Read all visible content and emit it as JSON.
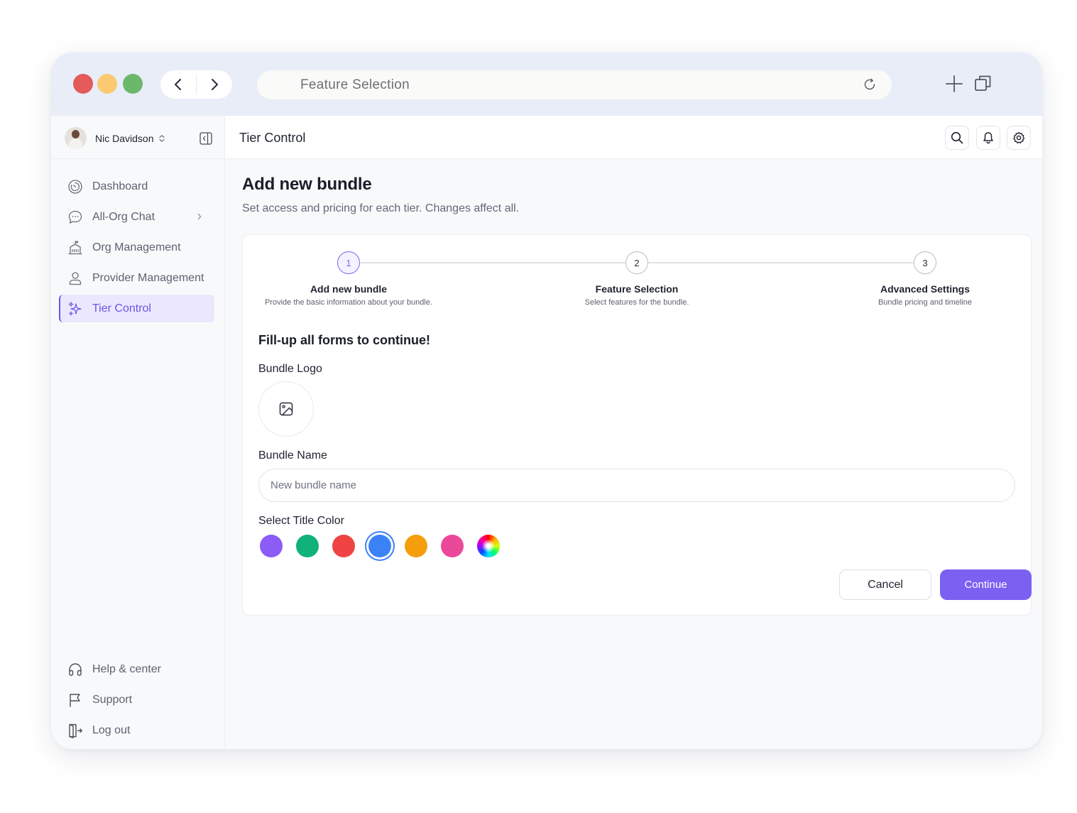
{
  "browser": {
    "address_text": "Feature Selection"
  },
  "user": {
    "name": "Nic Davidson"
  },
  "sidebar": {
    "items": [
      {
        "label": "Dashboard",
        "icon": "dashboard-icon"
      },
      {
        "label": "All-Org Chat",
        "icon": "chat-icon"
      },
      {
        "label": "Org Management",
        "icon": "building-icon"
      },
      {
        "label": "Provider Management",
        "icon": "user-icon"
      },
      {
        "label": "Tier Control",
        "icon": "sparkles-icon",
        "active": true
      }
    ],
    "bottom_items": [
      {
        "label": "Help & center",
        "icon": "headphones-icon"
      },
      {
        "label": "Support",
        "icon": "flag-icon"
      },
      {
        "label": "Log out",
        "icon": "logout-icon"
      }
    ]
  },
  "header": {
    "title": "Tier Control"
  },
  "page": {
    "title": "Add new bundle",
    "subtitle": "Set access and pricing for each tier. Changes affect all."
  },
  "stepper": {
    "steps": [
      {
        "number": "1",
        "label": "Add new bundle",
        "desc": "Provide the basic information about your bundle.",
        "active": true
      },
      {
        "number": "2",
        "label": "Feature Selection",
        "desc": "Select features for the bundle."
      },
      {
        "number": "3",
        "label": "Advanced Settings",
        "desc": "Bundle pricing and timeline"
      }
    ]
  },
  "form": {
    "heading": "Fill-up all forms to continue!",
    "logo_label": "Bundle Logo",
    "name_label": "Bundle Name",
    "name_placeholder": "New bundle name",
    "name_value": "",
    "color_label": "Select Title Color",
    "colors": [
      "#8b5cf6",
      "#10b27a",
      "#ef4444",
      "#3b82f6",
      "#f59e0b",
      "#ec4899",
      "custom"
    ],
    "selected_color": "#3b82f6"
  },
  "actions": {
    "cancel_label": "Cancel",
    "continue_label": "Continue"
  },
  "theme": {
    "accent": "#7b61f2",
    "active_bg": "#ebe8fd"
  }
}
